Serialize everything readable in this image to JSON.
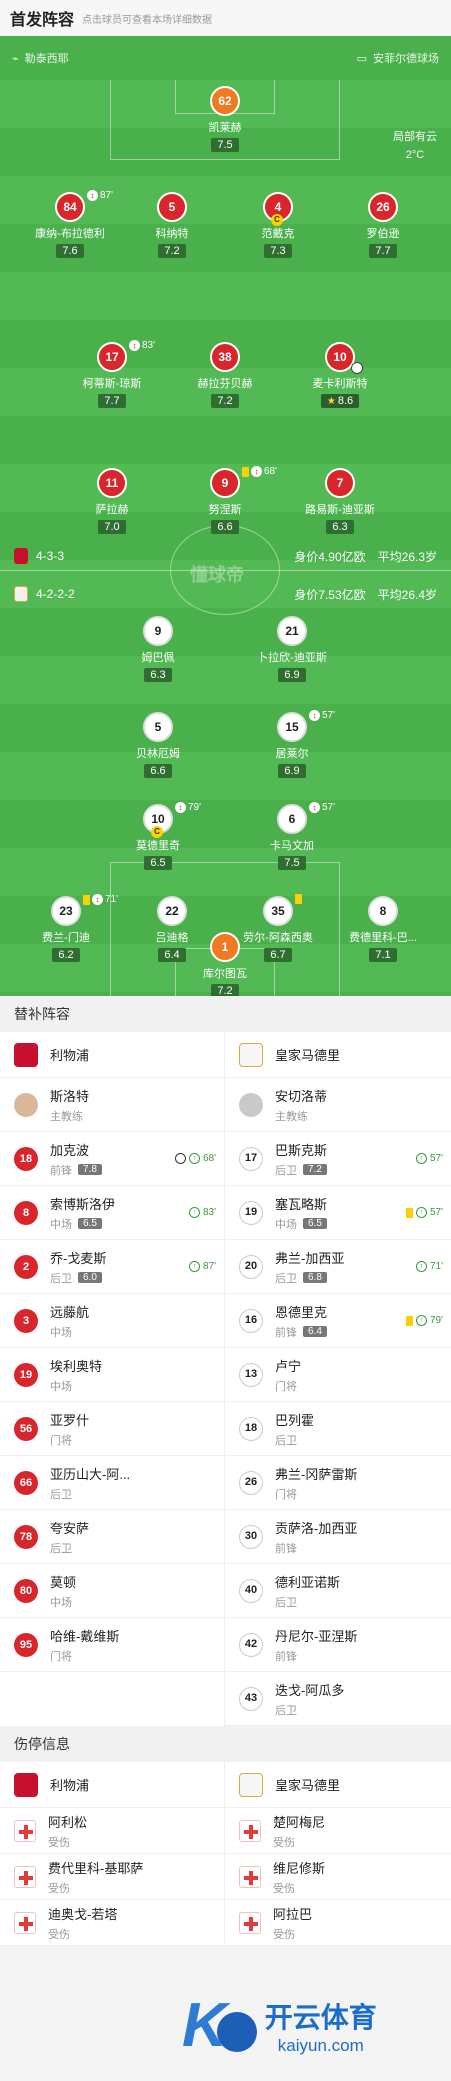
{
  "header": {
    "title": "首发阵容",
    "subtitle": "点击球员可查看本场详细数据"
  },
  "venue": {
    "stadium": "勒泰西耶",
    "referee": "安菲尔德球场"
  },
  "weather": {
    "condition": "局部有云",
    "temp": "2°C"
  },
  "home_formation": {
    "formation": "4-3-3",
    "value": "身价4.90亿欧",
    "age": "平均26.3岁"
  },
  "away_formation": {
    "formation": "4-2-2-2",
    "value": "身价7.53亿欧",
    "age": "平均26.4岁"
  },
  "watermark": "懂球帝",
  "home_players": [
    {
      "num": "62",
      "name": "凯莱赫",
      "rating": "7.5"
    },
    {
      "num": "84",
      "name": "康纳-布拉德利",
      "rating": "7.6",
      "event": "87'"
    },
    {
      "num": "5",
      "name": "科纳特",
      "rating": "7.2"
    },
    {
      "num": "4",
      "name": "范戴克",
      "rating": "7.3",
      "badge": "C"
    },
    {
      "num": "26",
      "name": "罗伯逊",
      "rating": "7.7"
    },
    {
      "num": "17",
      "name": "柯蒂斯-琼斯",
      "rating": "7.7",
      "event": "83'"
    },
    {
      "num": "38",
      "name": "赫拉芬贝赫",
      "rating": "7.2"
    },
    {
      "num": "10",
      "name": "麦卡利斯特",
      "rating": "8.6"
    },
    {
      "num": "11",
      "name": "萨拉赫",
      "rating": "7.0"
    },
    {
      "num": "9",
      "name": "努涅斯",
      "rating": "6.6",
      "event": "68'"
    },
    {
      "num": "7",
      "name": "路易斯-迪亚斯",
      "rating": "6.3"
    }
  ],
  "away_players": [
    {
      "num": "9",
      "name": "姆巴佩",
      "rating": "6.3"
    },
    {
      "num": "21",
      "name": "卜拉欣-迪亚斯",
      "rating": "6.9"
    },
    {
      "num": "5",
      "name": "贝林厄姆",
      "rating": "6.6"
    },
    {
      "num": "15",
      "name": "居莱尔",
      "rating": "6.9",
      "event": "57'"
    },
    {
      "num": "10",
      "name": "莫德里奇",
      "rating": "6.5",
      "event": "79'",
      "badge": "C"
    },
    {
      "num": "6",
      "name": "卡马文加",
      "rating": "7.5",
      "event": "57'"
    },
    {
      "num": "23",
      "name": "费兰-门迪",
      "rating": "6.2",
      "event": "71'"
    },
    {
      "num": "22",
      "name": "吕迪格",
      "rating": "6.4"
    },
    {
      "num": "35",
      "name": "劳尔-阿森西奥",
      "rating": "6.7"
    },
    {
      "num": "8",
      "name": "费德里科-巴...",
      "rating": "7.1"
    },
    {
      "num": "1",
      "name": "库尔图瓦",
      "rating": "7.2"
    }
  ],
  "subs": {
    "title": "替补阵容",
    "home_team": "利物浦",
    "away_team": "皇家马德里",
    "home_coach": {
      "name": "斯洛特",
      "role": "主教练"
    },
    "away_coach": {
      "name": "安切洛蒂",
      "role": "主教练"
    },
    "home": [
      {
        "num": "18",
        "name": "加克波",
        "pos": "前锋",
        "rating": "7.8",
        "event": "68'"
      },
      {
        "num": "8",
        "name": "索博斯洛伊",
        "pos": "中场",
        "rating": "6.5",
        "event": "83'"
      },
      {
        "num": "2",
        "name": "乔-戈麦斯",
        "pos": "后卫",
        "rating": "6.0",
        "event": "87'"
      },
      {
        "num": "3",
        "name": "远藤航",
        "pos": "中场"
      },
      {
        "num": "19",
        "name": "埃利奥特",
        "pos": "中场"
      },
      {
        "num": "56",
        "name": "亚罗什",
        "pos": "门将"
      },
      {
        "num": "66",
        "name": "亚历山大-阿...",
        "pos": "后卫"
      },
      {
        "num": "78",
        "name": "夸安萨",
        "pos": "后卫"
      },
      {
        "num": "80",
        "name": "莫顿",
        "pos": "中场"
      },
      {
        "num": "95",
        "name": "哈维-戴维斯",
        "pos": "门将"
      }
    ],
    "away": [
      {
        "num": "17",
        "name": "巴斯克斯",
        "pos": "后卫",
        "rating": "7.2",
        "event": "57'"
      },
      {
        "num": "19",
        "name": "塞瓦略斯",
        "pos": "中场",
        "rating": "6.5",
        "event": "57'"
      },
      {
        "num": "20",
        "name": "弗兰-加西亚",
        "pos": "后卫",
        "rating": "6.8",
        "event": "71'"
      },
      {
        "num": "16",
        "name": "恩德里克",
        "pos": "前锋",
        "rating": "6.4",
        "event": "79'"
      },
      {
        "num": "13",
        "name": "卢宁",
        "pos": "门将"
      },
      {
        "num": "18",
        "name": "巴列霍",
        "pos": "后卫"
      },
      {
        "num": "26",
        "name": "弗兰-冈萨雷斯",
        "pos": "门将"
      },
      {
        "num": "30",
        "name": "贡萨洛-加西亚",
        "pos": "前锋"
      },
      {
        "num": "40",
        "name": "德利亚诺斯",
        "pos": "后卫"
      },
      {
        "num": "42",
        "name": "丹尼尔-亚涅斯",
        "pos": "前锋"
      },
      {
        "num": "43",
        "name": "迭戈-阿瓜多",
        "pos": "后卫"
      }
    ]
  },
  "injuries": {
    "title": "伤停信息",
    "home": [
      {
        "name": "阿利松",
        "status": "受伤"
      },
      {
        "name": "费代里科-基耶萨",
        "status": "受伤"
      },
      {
        "name": "迪奥戈-若塔",
        "status": "受伤"
      }
    ],
    "away": [
      {
        "name": "楚阿梅尼",
        "status": "受伤"
      },
      {
        "name": "维尼修斯",
        "status": "受伤"
      },
      {
        "name": "阿拉巴",
        "status": "受伤"
      }
    ]
  },
  "logo": {
    "mark": "K",
    "brand": "开云体育",
    "domain": "kaiyun.com"
  },
  "colors": {
    "pitch": "#49b04b",
    "home": "#d8262c",
    "gk": "#f07a22",
    "rating": "#2f6d31"
  }
}
